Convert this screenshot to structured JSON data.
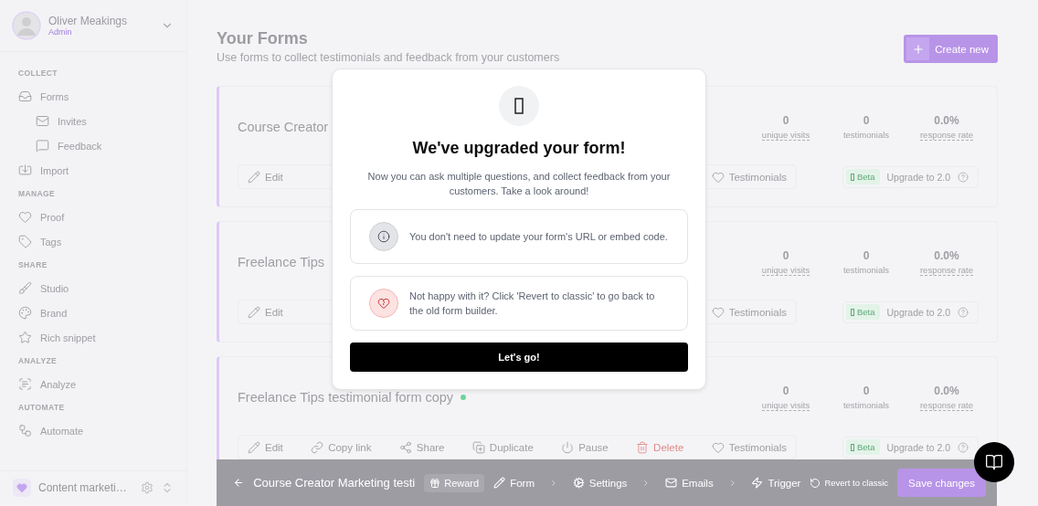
{
  "sidebar": {
    "user": {
      "name": "Oliver Meakings",
      "role": "Admin"
    },
    "sections": [
      {
        "heading": "COLLECT",
        "items": [
          {
            "label": "Forms",
            "kind": "forms",
            "children": [
              {
                "label": "Invites",
                "kind": "invites"
              },
              {
                "label": "Feedback",
                "kind": "feedback"
              }
            ]
          },
          {
            "label": "Import",
            "kind": "import"
          }
        ]
      },
      {
        "heading": "MANAGE",
        "items": [
          {
            "label": "Proof",
            "kind": "proof"
          },
          {
            "label": "Tags",
            "kind": "tags"
          }
        ]
      },
      {
        "heading": "SHARE",
        "items": [
          {
            "label": "Studio",
            "kind": "studio"
          },
          {
            "label": "Brand",
            "kind": "brand"
          },
          {
            "label": "Rich snippet",
            "kind": "snippet"
          }
        ]
      },
      {
        "heading": "ANALYZE",
        "items": [
          {
            "label": "Analyze",
            "kind": "analyze"
          }
        ]
      },
      {
        "heading": "AUTOMATE",
        "items": [
          {
            "label": "Automate",
            "kind": "automate"
          }
        ]
      }
    ],
    "workspace": {
      "name": "Content marketi…"
    }
  },
  "page": {
    "title": "Your Forms",
    "subtitle": "Use forms to collect testimonials and feedback from your customers",
    "create_button": "Create new"
  },
  "forms": [
    {
      "title": "Course Creator",
      "stats": [
        {
          "value": "0",
          "label": "unique visits",
          "underlined": true
        },
        {
          "value": "0",
          "label": "testimonials",
          "underlined": false
        },
        {
          "value": "0.0%",
          "label": "response rate",
          "underlined": true
        }
      ],
      "actions": [
        {
          "label": "Edit",
          "kind": "edit"
        },
        {
          "label": "Testimonials",
          "kind": "testimonials"
        }
      ],
      "badge": "Beta",
      "upgrade": "Upgrade to 2.0"
    },
    {
      "title": "Freelance Tips",
      "stats": [
        {
          "value": "0",
          "label": "unique visits",
          "underlined": true
        },
        {
          "value": "0",
          "label": "testimonials",
          "underlined": false
        },
        {
          "value": "0.0%",
          "label": "response rate",
          "underlined": true
        }
      ],
      "actions": [
        {
          "label": "Edit",
          "kind": "edit"
        },
        {
          "label": "Testimonials",
          "kind": "testimonials"
        }
      ],
      "badge": "Beta",
      "upgrade": "Upgrade to 2.0"
    },
    {
      "title": "Freelance Tips testimonial form copy",
      "active": true,
      "stats": [
        {
          "value": "0",
          "label": "unique visits",
          "underlined": true
        },
        {
          "value": "0",
          "label": "testimonials",
          "underlined": false
        },
        {
          "value": "0.0%",
          "label": "response rate",
          "underlined": true
        }
      ],
      "actions": [
        {
          "label": "Edit",
          "kind": "edit"
        },
        {
          "label": "Copy link",
          "kind": "copy"
        },
        {
          "label": "Share",
          "kind": "share"
        },
        {
          "label": "Duplicate",
          "kind": "duplicate"
        },
        {
          "label": "Pause",
          "kind": "pause"
        },
        {
          "label": "Delete",
          "kind": "delete"
        },
        {
          "label": "Testimonials",
          "kind": "testimonials"
        }
      ],
      "badge": "Beta",
      "upgrade": "Upgrade to 2.0"
    }
  ],
  "editor_bar": {
    "title": "Course Creator Marketing testi",
    "reward": "Reward",
    "steps": [
      {
        "label": "Form",
        "kind": "form"
      },
      {
        "label": "Settings",
        "kind": "settings"
      },
      {
        "label": "Emails",
        "kind": "emails"
      },
      {
        "label": "Trigger",
        "kind": "trigger"
      }
    ],
    "revert": "Revert to classic",
    "save": "Save changes"
  },
  "modal": {
    "title": "We've upgraded your form!",
    "text": "Now you can ask multiple questions, and collect feedback from your customers. Take a look around!",
    "notes": [
      {
        "kind": "info",
        "text": "You don't need to update your form's URL or embed code."
      },
      {
        "kind": "heartbreak",
        "text": "Not happy with it? Click 'Revert to classic' to go back to the old form builder."
      }
    ],
    "button": "Let's go!"
  }
}
